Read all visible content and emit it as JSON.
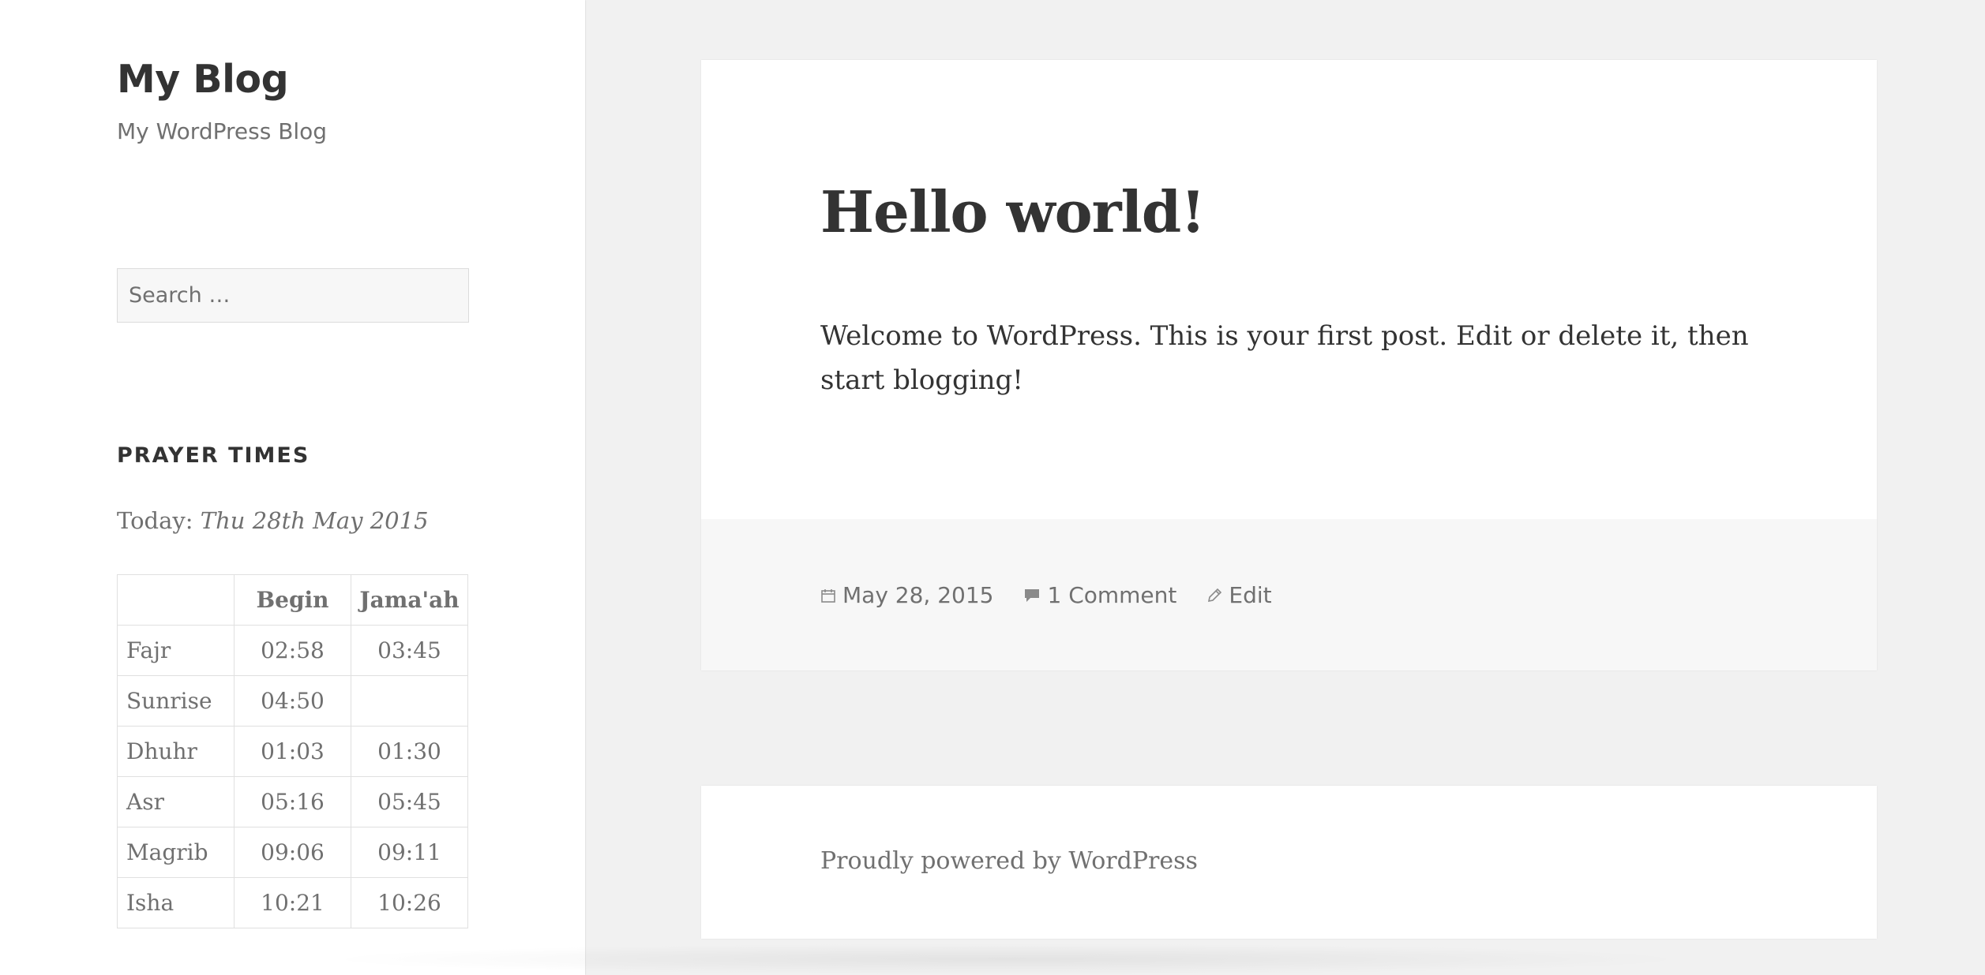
{
  "site": {
    "title": "My Blog",
    "description": "My WordPress Blog"
  },
  "search": {
    "placeholder": "Search …"
  },
  "prayer_widget": {
    "title": "PRAYER TIMES",
    "today_label": "Today:",
    "today_date": "Thu 28th May 2015",
    "headers": [
      "",
      "Begin",
      "Jama'ah"
    ],
    "rows": [
      {
        "name": "Fajr",
        "begin": "02:58",
        "jamaah": "03:45"
      },
      {
        "name": "Sunrise",
        "begin": "04:50",
        "jamaah": ""
      },
      {
        "name": "Dhuhr",
        "begin": "01:03",
        "jamaah": "01:30"
      },
      {
        "name": "Asr",
        "begin": "05:16",
        "jamaah": "05:45"
      },
      {
        "name": "Magrib",
        "begin": "09:06",
        "jamaah": "09:11"
      },
      {
        "name": "Isha",
        "begin": "10:21",
        "jamaah": "10:26"
      }
    ]
  },
  "post": {
    "title": "Hello world!",
    "body": "Welcome to WordPress. This is your first post. Edit or delete it, then start blogging!",
    "date": "May 28, 2015",
    "comments": "1 Comment",
    "edit": "Edit",
    "icons": [
      "calendar-icon",
      "comment-icon",
      "pencil-icon"
    ]
  },
  "footer": {
    "powered_by": "Proudly powered by WordPress"
  }
}
